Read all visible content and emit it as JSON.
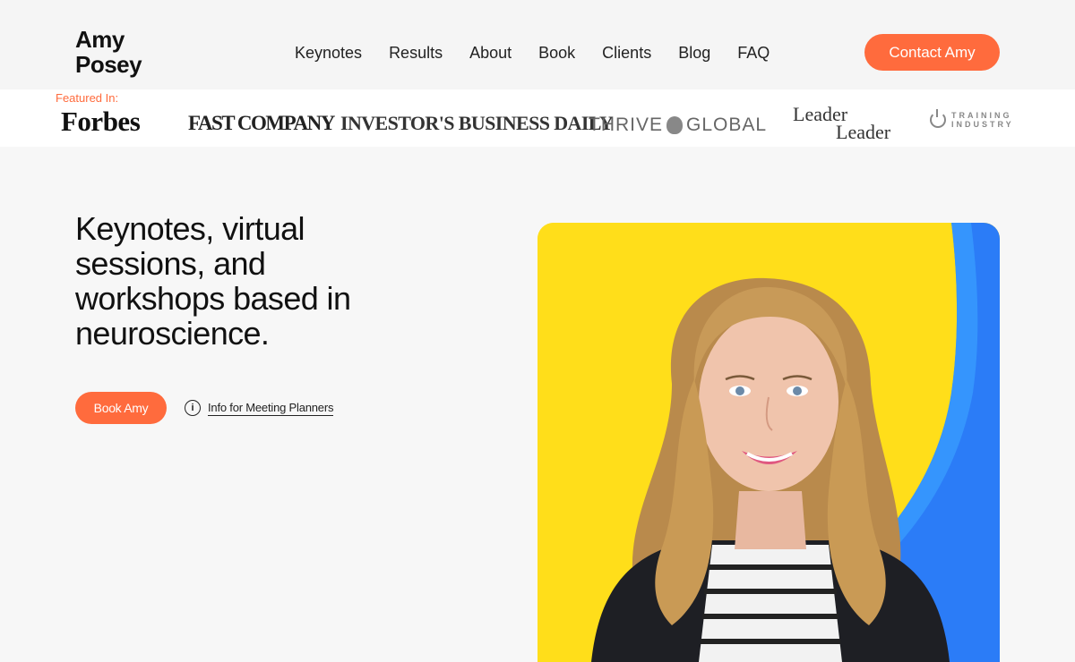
{
  "header": {
    "logo": "Amy\nPosey",
    "nav": [
      "Keynotes",
      "Results",
      "About",
      "Book",
      "Clients",
      "Blog",
      "FAQ"
    ],
    "contact_label": "Contact Amy"
  },
  "featured": {
    "label": "Featured In:",
    "logos": {
      "forbes": "Forbes",
      "fast_company": "FAST COMPANY",
      "ibd": "INVESTOR'S BUSINESS DAILY",
      "thrive_left": "THRIVE",
      "thrive_right": "GLOBAL",
      "leader_1": "Leader",
      "leader_2": "Leader",
      "training_1": "TRAINING",
      "training_2": "INDUSTRY"
    }
  },
  "hero": {
    "title": "Keynotes, virtual sessions, and workshops based in neuroscience.",
    "book_label": "Book Amy",
    "info_label": "Info for Meeting Planners"
  },
  "colors": {
    "accent": "#ff6b3d",
    "photo_yellow": "#ffde1a",
    "photo_blue": "#2b7cf7"
  }
}
